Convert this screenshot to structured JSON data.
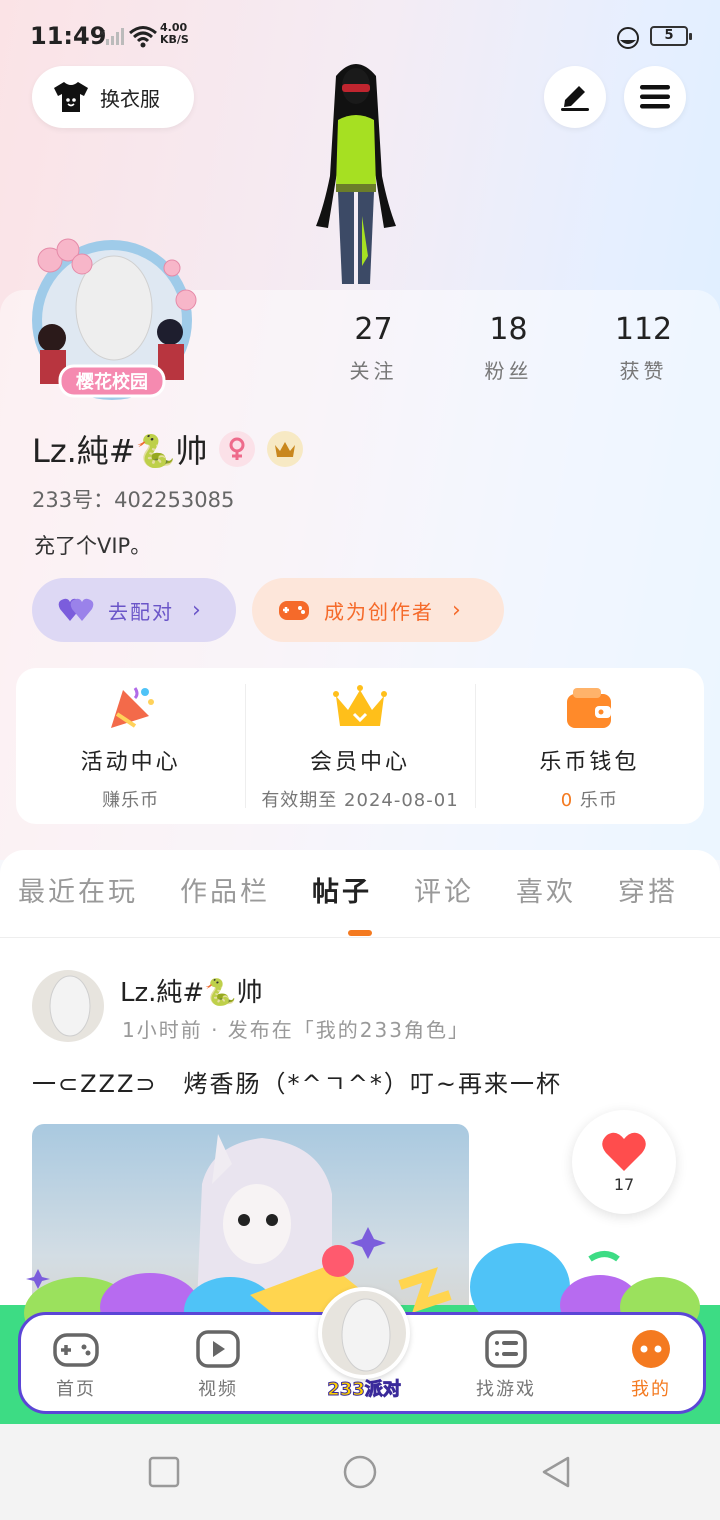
{
  "status_bar": {
    "time": "11:49",
    "net_speed_value": "4.00",
    "net_speed_unit": "KB/S",
    "battery": "5"
  },
  "header": {
    "dress_button_label": "换衣服"
  },
  "profile": {
    "avatar_frame_text": "樱花校园",
    "stats": [
      {
        "value": "27",
        "label": "关注"
      },
      {
        "value": "18",
        "label": "粉丝"
      },
      {
        "value": "112",
        "label": "获赞"
      }
    ],
    "username_prefix": "Lz.純#",
    "username_emoji": "🐍",
    "username_suffix": "帅",
    "id_label": "233号：",
    "id_value": "402253085",
    "bio": "充了个VIP。",
    "match_button": "去配对",
    "creator_button": "成为创作者"
  },
  "quick_links": [
    {
      "title": "活动中心",
      "subtitle": "赚乐币"
    },
    {
      "title": "会员中心",
      "subtitle": "有效期至 2024-08-01"
    },
    {
      "title": "乐币钱包",
      "coin_count": "0",
      "subtitle": "乐币"
    }
  ],
  "tabs": [
    "最近在玩",
    "作品栏",
    "帖子",
    "评论",
    "喜欢",
    "穿搭"
  ],
  "active_tab": "帖子",
  "post": {
    "author_prefix": "Lz.純#",
    "author_emoji": "🐍",
    "author_suffix": "帅",
    "meta": "1小时前 · 发布在「我的233角色」",
    "text": "一⊂ZZZ⊃　烤香肠（*^ㄱ^*）叮~再来一杯",
    "like_count": "17"
  },
  "bottom_nav": [
    {
      "label": "首页"
    },
    {
      "label": "视频"
    },
    {
      "label": "233派对"
    },
    {
      "label": "找游戏"
    },
    {
      "label": "我的"
    }
  ],
  "colors": {
    "accent": "#f47a20",
    "nav_border": "#5b46d6",
    "match_purple": "#6a55c8",
    "like_red": "#ff4d4d"
  }
}
